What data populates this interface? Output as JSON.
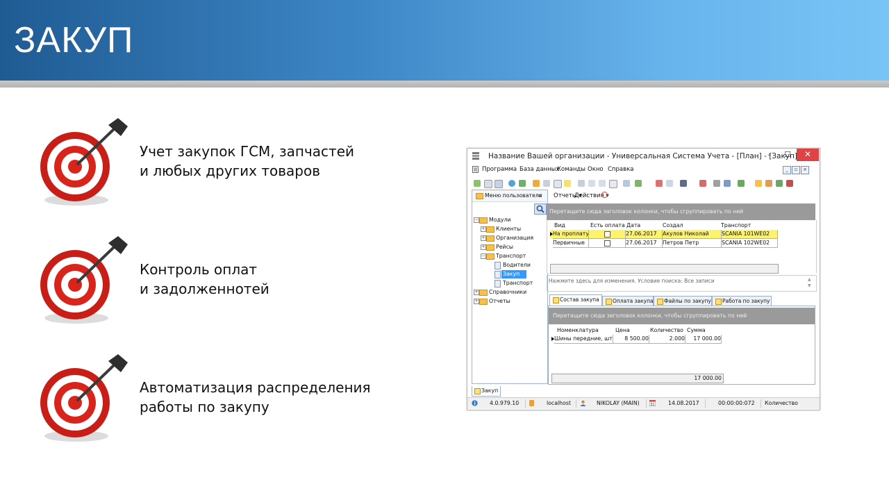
{
  "slide": {
    "title": "ЗАКУП",
    "bullets": [
      {
        "line1": "Учет закупок ГСМ, запчастей",
        "line2": "и любых других товаров",
        "icon": "target-icon"
      },
      {
        "line1": "Контроль оплат",
        "line2": "и задолженнотей",
        "icon": "target-icon"
      },
      {
        "line1": "Автоматизация распределения",
        "line2": "работы по закупу",
        "icon": "target-icon"
      }
    ]
  },
  "window": {
    "title": "Название Вашей организации - Универсальная Система Учета - [План] - [Закуп]",
    "controls": {
      "minimize": "–",
      "maximize": "☐",
      "close": "✕"
    }
  },
  "menu": {
    "items": [
      "Программа",
      "База данных",
      "Команды",
      "Окно",
      "Справка"
    ],
    "mdi": [
      "_",
      "▫",
      "×"
    ]
  },
  "left_panel": {
    "title": "Меню пользователя",
    "pin": "ⱺ",
    "tree": [
      {
        "label": "Модули",
        "expander": "−"
      },
      {
        "label": "Клиенты",
        "expander": "+"
      },
      {
        "label": "Организация",
        "expander": "+"
      },
      {
        "label": "Рейсы",
        "expander": "+"
      },
      {
        "label": "Транспорт",
        "expander": "−"
      },
      {
        "label": "Водители"
      },
      {
        "label": "Закуп"
      },
      {
        "label": "Транспорт"
      },
      {
        "label": "Справочники",
        "expander": "+"
      },
      {
        "label": "Отчеты",
        "expander": "+"
      }
    ]
  },
  "subtoolbar": {
    "reports": "Отчеты ▾",
    "actions": "Действия ▾"
  },
  "grid1": {
    "group_hint": "Перетащите сюда заголовок колонки, чтобы сгруппировать по ней",
    "columns": [
      "Вид",
      "Есть оплата",
      "Дата",
      "Создал",
      "Транспорт"
    ],
    "rows": [
      {
        "vid": "На проплату",
        "date": "27.06.2017",
        "creator": "Акулов Николай",
        "transport": "SCANIA 101WE02"
      },
      {
        "vid": "Первичные",
        "date": "27.06.2017",
        "creator": "Петров Петр",
        "transport": "SCANIA 102WE02"
      }
    ],
    "filter_text": "Нажмите здесь для изменения. Условие поиска: Все записи"
  },
  "tabs": [
    "Состав закупа",
    "Оплата закупа",
    "Файлы по закупу",
    "Работа по закупу"
  ],
  "grid2": {
    "group_hint": "Перетащите сюда заголовок колонки, чтобы сгруппировать по ней",
    "columns": [
      "Номенклатура",
      "Цена",
      "Количество",
      "Сумма"
    ],
    "row": {
      "name": "Шины передние, шт",
      "price": "8 500.00",
      "qty": "2.000",
      "sum": "17 000.00"
    },
    "total": "17 000.00"
  },
  "bottom_tab": "Закуп",
  "status": {
    "version": "4.0.979.10",
    "server": "localhost",
    "user": "NIKOLAY (MAIN)",
    "date": "14.08.2017",
    "timer": "00:00:00:072",
    "field": "Количество",
    "calendar_day": "31"
  },
  "colors": {
    "header_dark": "#1f5b93",
    "header_light": "#79c4f6",
    "highlight_row": "#fbf36c",
    "selection": "#3399ff",
    "close_button": "#e04343",
    "target_red": "#d9241c"
  }
}
